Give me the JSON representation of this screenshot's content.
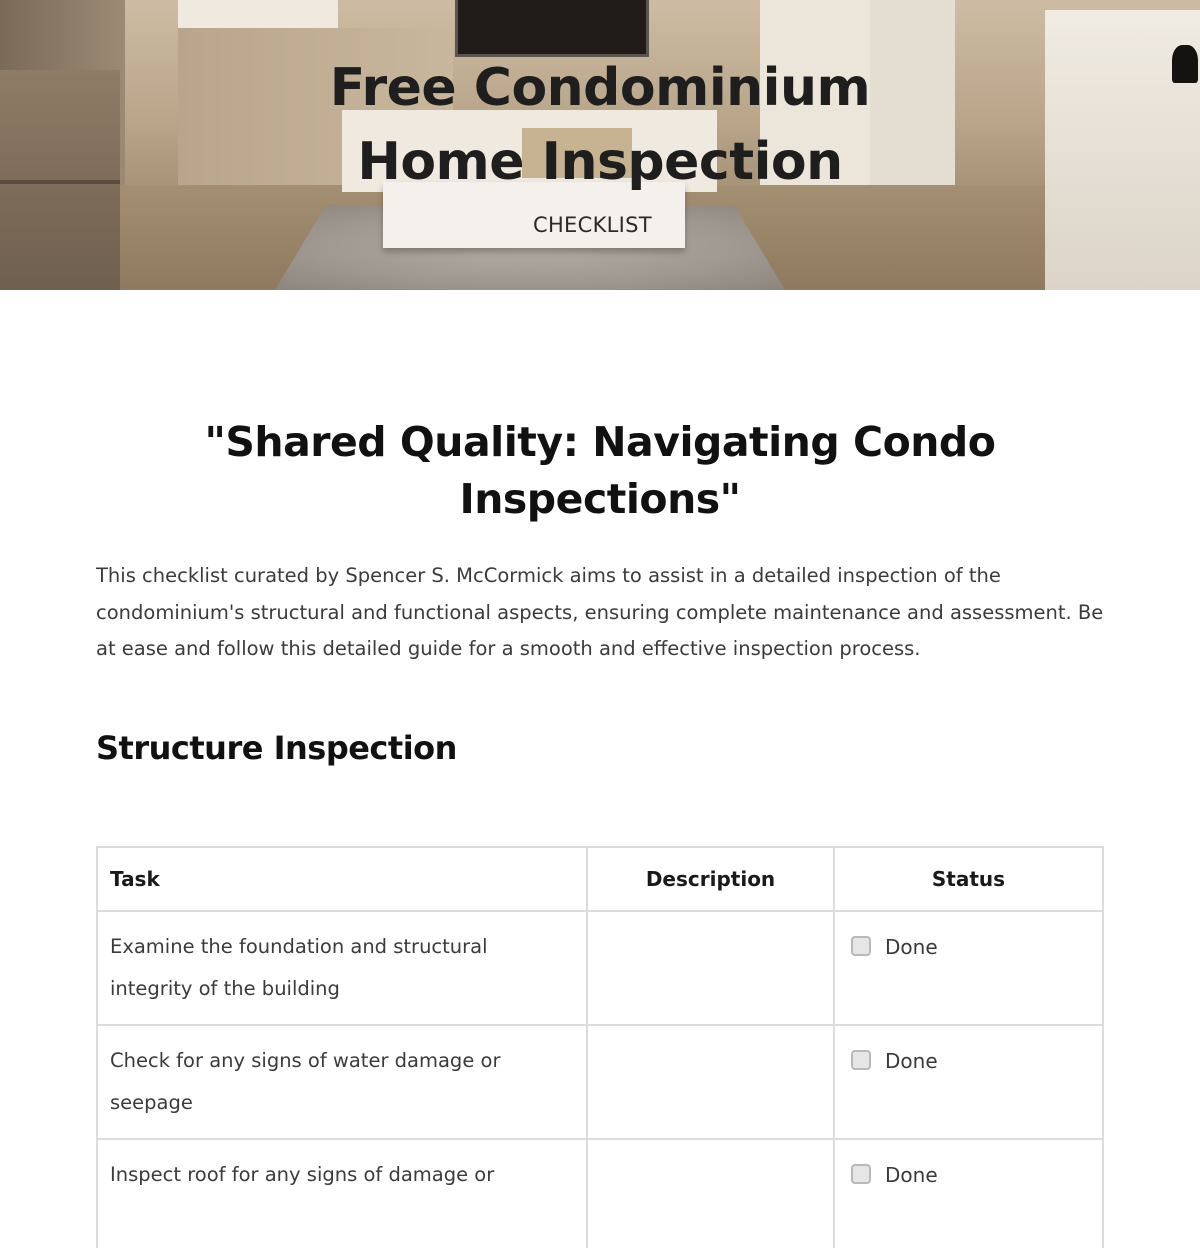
{
  "hero": {
    "title_line1": "Free Condominium",
    "title_line2": "Home Inspection",
    "subtitle": "CHECKLIST"
  },
  "document": {
    "title_line1": "\"Shared Quality: Navigating Condo",
    "title_line2": "Inspections\"",
    "intro": "This checklist curated by Spencer S. McCormick aims to assist in a detailed inspection of the condominium's structural and functional aspects, ensuring complete maintenance and assessment. Be at ease and follow this detailed guide for a smooth and effective inspection process."
  },
  "sections": [
    {
      "heading": "Structure Inspection",
      "table": {
        "headers": {
          "task": "Task",
          "description": "Description",
          "status": "Status"
        },
        "rows": [
          {
            "task": "Examine the foundation and structural integrity of the building",
            "description": "",
            "status_label": "Done",
            "checked": false
          },
          {
            "task": "Check for any signs of water damage or seepage",
            "description": "",
            "status_label": "Done",
            "checked": false
          },
          {
            "task": "Inspect roof for any signs of damage or",
            "description": "",
            "status_label": "Done",
            "checked": false
          }
        ]
      }
    }
  ]
}
